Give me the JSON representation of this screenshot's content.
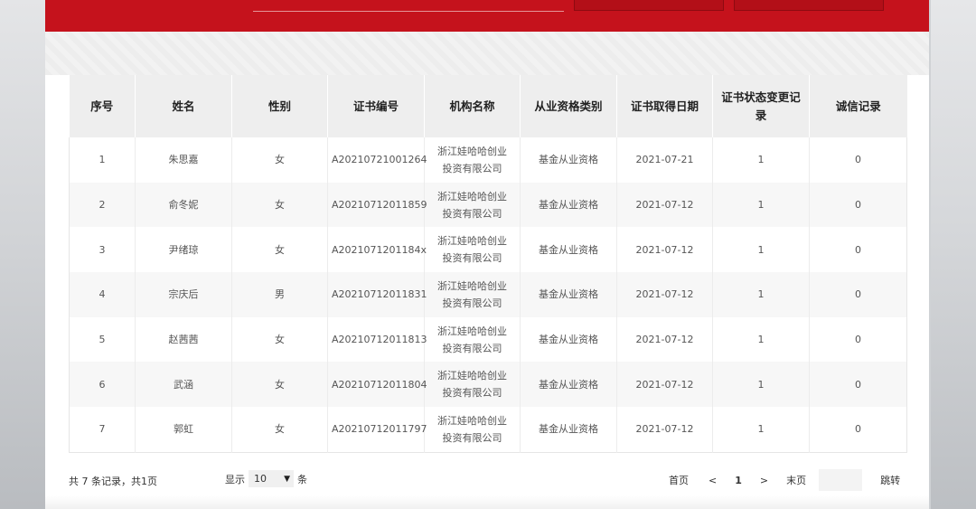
{
  "table": {
    "headers": [
      "序号",
      "姓名",
      "性别",
      "证书编号",
      "机构名称",
      "从业资格类别",
      "证书取得日期",
      "证书状态变更记录",
      "诚信记录"
    ],
    "rows": [
      [
        "1",
        "朱思嘉",
        "女",
        "A20210721001264",
        "浙江娃哈哈创业投资有限公司",
        "基金从业资格",
        "2021-07-21",
        "1",
        "0"
      ],
      [
        "2",
        "俞冬妮",
        "女",
        "A20210712011859",
        "浙江娃哈哈创业投资有限公司",
        "基金从业资格",
        "2021-07-12",
        "1",
        "0"
      ],
      [
        "3",
        "尹绪琼",
        "女",
        "A2021071201184x",
        "浙江娃哈哈创业投资有限公司",
        "基金从业资格",
        "2021-07-12",
        "1",
        "0"
      ],
      [
        "4",
        "宗庆后",
        "男",
        "A20210712011831",
        "浙江娃哈哈创业投资有限公司",
        "基金从业资格",
        "2021-07-12",
        "1",
        "0"
      ],
      [
        "5",
        "赵茜茜",
        "女",
        "A20210712011813",
        "浙江娃哈哈创业投资有限公司",
        "基金从业资格",
        "2021-07-12",
        "1",
        "0"
      ],
      [
        "6",
        "武涵",
        "女",
        "A20210712011804",
        "浙江娃哈哈创业投资有限公司",
        "基金从业资格",
        "2021-07-12",
        "1",
        "0"
      ],
      [
        "7",
        "郭虹",
        "女",
        "A20210712011797",
        "浙江娃哈哈创业投资有限公司",
        "基金从业资格",
        "2021-07-12",
        "1",
        "0"
      ]
    ]
  },
  "footer": {
    "summary": "共 7 条记录，共1页",
    "show_label": "显示",
    "page_size": "10",
    "unit_label": "条",
    "first": "首页",
    "prev": "<",
    "current_page": "1",
    "next": ">",
    "last": "末页",
    "jump": "跳转"
  },
  "colors": {
    "brand_red": "#c5121c",
    "header_bg": "#eeeeee",
    "row_alt_bg": "#f7f7f7"
  },
  "icons": {
    "page_size_dropdown": "chevron-down-icon"
  }
}
